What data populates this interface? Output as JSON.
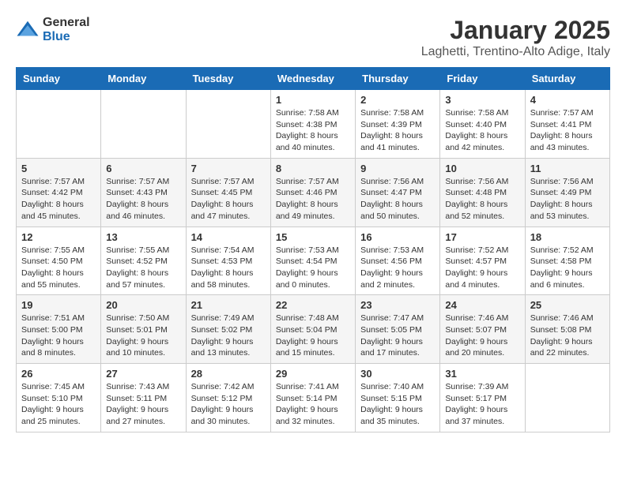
{
  "logo": {
    "general": "General",
    "blue": "Blue"
  },
  "title": "January 2025",
  "location": "Laghetti, Trentino-Alto Adige, Italy",
  "days_of_week": [
    "Sunday",
    "Monday",
    "Tuesday",
    "Wednesday",
    "Thursday",
    "Friday",
    "Saturday"
  ],
  "weeks": [
    [
      {
        "day": "",
        "info": ""
      },
      {
        "day": "",
        "info": ""
      },
      {
        "day": "",
        "info": ""
      },
      {
        "day": "1",
        "info": "Sunrise: 7:58 AM\nSunset: 4:38 PM\nDaylight: 8 hours\nand 40 minutes."
      },
      {
        "day": "2",
        "info": "Sunrise: 7:58 AM\nSunset: 4:39 PM\nDaylight: 8 hours\nand 41 minutes."
      },
      {
        "day": "3",
        "info": "Sunrise: 7:58 AM\nSunset: 4:40 PM\nDaylight: 8 hours\nand 42 minutes."
      },
      {
        "day": "4",
        "info": "Sunrise: 7:57 AM\nSunset: 4:41 PM\nDaylight: 8 hours\nand 43 minutes."
      }
    ],
    [
      {
        "day": "5",
        "info": "Sunrise: 7:57 AM\nSunset: 4:42 PM\nDaylight: 8 hours\nand 45 minutes."
      },
      {
        "day": "6",
        "info": "Sunrise: 7:57 AM\nSunset: 4:43 PM\nDaylight: 8 hours\nand 46 minutes."
      },
      {
        "day": "7",
        "info": "Sunrise: 7:57 AM\nSunset: 4:45 PM\nDaylight: 8 hours\nand 47 minutes."
      },
      {
        "day": "8",
        "info": "Sunrise: 7:57 AM\nSunset: 4:46 PM\nDaylight: 8 hours\nand 49 minutes."
      },
      {
        "day": "9",
        "info": "Sunrise: 7:56 AM\nSunset: 4:47 PM\nDaylight: 8 hours\nand 50 minutes."
      },
      {
        "day": "10",
        "info": "Sunrise: 7:56 AM\nSunset: 4:48 PM\nDaylight: 8 hours\nand 52 minutes."
      },
      {
        "day": "11",
        "info": "Sunrise: 7:56 AM\nSunset: 4:49 PM\nDaylight: 8 hours\nand 53 minutes."
      }
    ],
    [
      {
        "day": "12",
        "info": "Sunrise: 7:55 AM\nSunset: 4:50 PM\nDaylight: 8 hours\nand 55 minutes."
      },
      {
        "day": "13",
        "info": "Sunrise: 7:55 AM\nSunset: 4:52 PM\nDaylight: 8 hours\nand 57 minutes."
      },
      {
        "day": "14",
        "info": "Sunrise: 7:54 AM\nSunset: 4:53 PM\nDaylight: 8 hours\nand 58 minutes."
      },
      {
        "day": "15",
        "info": "Sunrise: 7:53 AM\nSunset: 4:54 PM\nDaylight: 9 hours\nand 0 minutes."
      },
      {
        "day": "16",
        "info": "Sunrise: 7:53 AM\nSunset: 4:56 PM\nDaylight: 9 hours\nand 2 minutes."
      },
      {
        "day": "17",
        "info": "Sunrise: 7:52 AM\nSunset: 4:57 PM\nDaylight: 9 hours\nand 4 minutes."
      },
      {
        "day": "18",
        "info": "Sunrise: 7:52 AM\nSunset: 4:58 PM\nDaylight: 9 hours\nand 6 minutes."
      }
    ],
    [
      {
        "day": "19",
        "info": "Sunrise: 7:51 AM\nSunset: 5:00 PM\nDaylight: 9 hours\nand 8 minutes."
      },
      {
        "day": "20",
        "info": "Sunrise: 7:50 AM\nSunset: 5:01 PM\nDaylight: 9 hours\nand 10 minutes."
      },
      {
        "day": "21",
        "info": "Sunrise: 7:49 AM\nSunset: 5:02 PM\nDaylight: 9 hours\nand 13 minutes."
      },
      {
        "day": "22",
        "info": "Sunrise: 7:48 AM\nSunset: 5:04 PM\nDaylight: 9 hours\nand 15 minutes."
      },
      {
        "day": "23",
        "info": "Sunrise: 7:47 AM\nSunset: 5:05 PM\nDaylight: 9 hours\nand 17 minutes."
      },
      {
        "day": "24",
        "info": "Sunrise: 7:46 AM\nSunset: 5:07 PM\nDaylight: 9 hours\nand 20 minutes."
      },
      {
        "day": "25",
        "info": "Sunrise: 7:46 AM\nSunset: 5:08 PM\nDaylight: 9 hours\nand 22 minutes."
      }
    ],
    [
      {
        "day": "26",
        "info": "Sunrise: 7:45 AM\nSunset: 5:10 PM\nDaylight: 9 hours\nand 25 minutes."
      },
      {
        "day": "27",
        "info": "Sunrise: 7:43 AM\nSunset: 5:11 PM\nDaylight: 9 hours\nand 27 minutes."
      },
      {
        "day": "28",
        "info": "Sunrise: 7:42 AM\nSunset: 5:12 PM\nDaylight: 9 hours\nand 30 minutes."
      },
      {
        "day": "29",
        "info": "Sunrise: 7:41 AM\nSunset: 5:14 PM\nDaylight: 9 hours\nand 32 minutes."
      },
      {
        "day": "30",
        "info": "Sunrise: 7:40 AM\nSunset: 5:15 PM\nDaylight: 9 hours\nand 35 minutes."
      },
      {
        "day": "31",
        "info": "Sunrise: 7:39 AM\nSunset: 5:17 PM\nDaylight: 9 hours\nand 37 minutes."
      },
      {
        "day": "",
        "info": ""
      }
    ]
  ]
}
